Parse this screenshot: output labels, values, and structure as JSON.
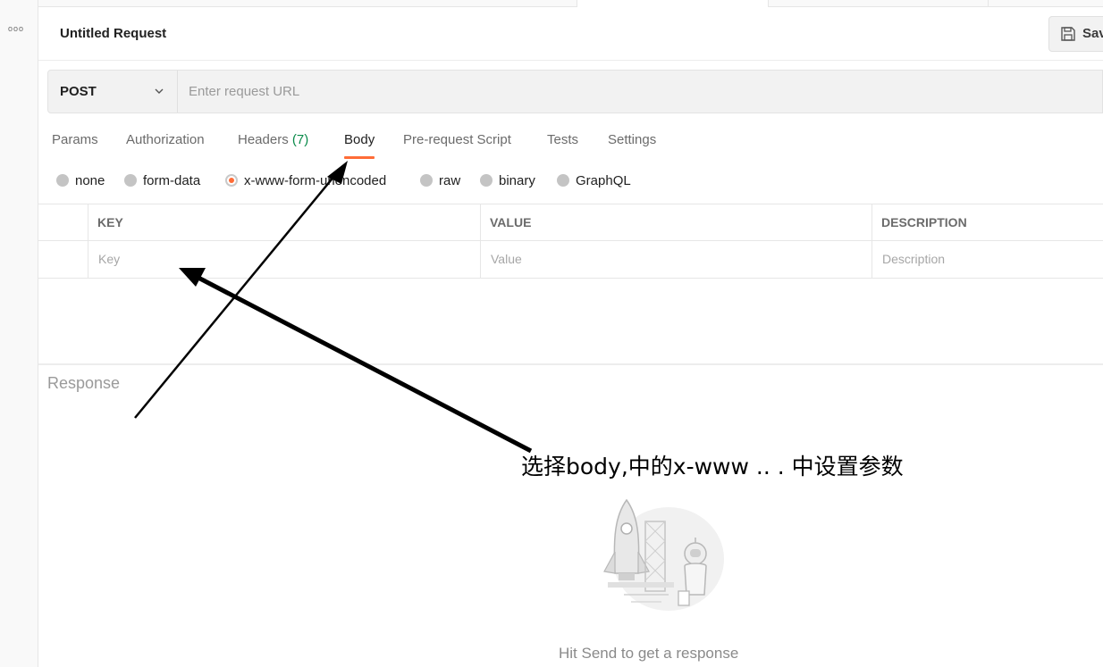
{
  "sidebar": {
    "more_icon": "ooo"
  },
  "request": {
    "title": "Untitled Request",
    "save_label": "Sav",
    "method": "POST",
    "url_placeholder": "Enter request URL"
  },
  "tabs": [
    {
      "label": "Params"
    },
    {
      "label": "Authorization"
    },
    {
      "label": "Headers",
      "count": "(7)"
    },
    {
      "label": "Body",
      "active": true
    },
    {
      "label": "Pre-request Script"
    },
    {
      "label": "Tests"
    },
    {
      "label": "Settings"
    }
  ],
  "body_types": [
    {
      "label": "none"
    },
    {
      "label": "form-data"
    },
    {
      "label": "x-www-form-urlencoded",
      "selected": true
    },
    {
      "label": "raw"
    },
    {
      "label": "binary"
    },
    {
      "label": "GraphQL"
    }
  ],
  "params_table": {
    "headers": [
      "KEY",
      "VALUE",
      "DESCRIPTION"
    ],
    "placeholders": [
      "Key",
      "Value",
      "Description"
    ]
  },
  "response": {
    "label": "Response",
    "empty_hint": "Hit Send to get a response"
  },
  "annotation": {
    "text": "选择body,中的x-www  .. . 中设置参数"
  },
  "colors": {
    "accent": "#ff6c37",
    "headers_count": "#0a8a4a"
  },
  "icons": [
    "more-icon",
    "save-icon",
    "chevron-down-icon",
    "rocket-illustration"
  ]
}
